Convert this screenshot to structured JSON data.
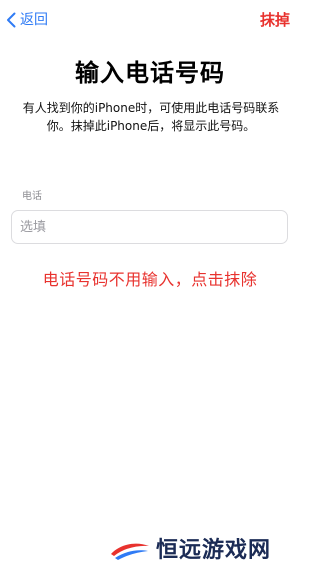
{
  "nav": {
    "back_label": "返回",
    "erase_label": "抹掉"
  },
  "main": {
    "title": "输入电话号码",
    "description": "有人找到你的iPhone时，可使用此电话号码联系你。抹掉此iPhone后，将显示此号码。"
  },
  "phone_field": {
    "label": "电话",
    "placeholder": "选填",
    "value": ""
  },
  "annotation": {
    "text": "电话号码不用输入，点击抹除"
  },
  "watermark": {
    "text": "恒远游戏网"
  },
  "colors": {
    "accent_blue": "#2f7bf5",
    "accent_red": "#e8322e"
  },
  "icons": {
    "back": "chevron-left-icon",
    "watermark_logo": "swoosh-logo-icon"
  }
}
